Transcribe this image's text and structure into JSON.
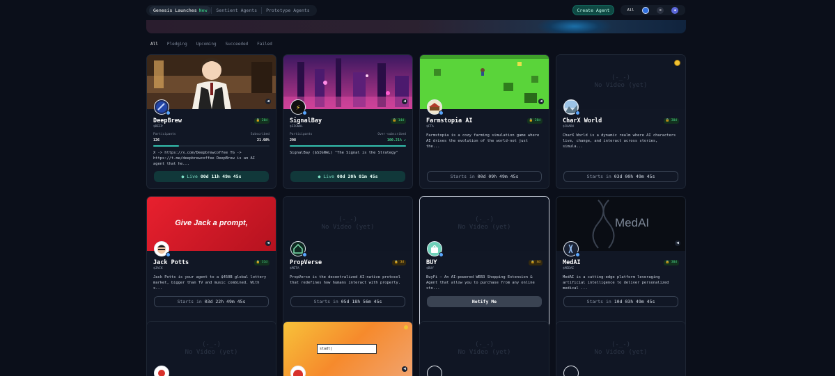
{
  "nav": {
    "tabs": [
      {
        "label": "Genesis Launches",
        "badge": "New"
      },
      {
        "label": "Sentient Agents"
      },
      {
        "label": "Prototype Agents"
      }
    ],
    "create_label": "Create Agent",
    "chain_filter_all": "All"
  },
  "filters": [
    "All",
    "Pledging",
    "Upcoming",
    "Succeeded",
    "Failed"
  ],
  "novideo": {
    "face": "(-_-)",
    "text": "No Video (yet)"
  },
  "cards": [
    {
      "name": "DeepBrew",
      "ticker": "$DEEP",
      "days": "20d",
      "participants_label": "Participants",
      "participants": "126",
      "subscribed_label": "Subscribed",
      "subscribed": "21.98%",
      "progress": 0.22,
      "desc": "X -> https://x.com/Deepbrewcoffee TG -> https://t.me/deepbrewcoffee DeepBrew is an AI agent that he...",
      "cta_prefix": "● Live",
      "cta_time": "00d 11h 49m 45s"
    },
    {
      "name": "SignalBay",
      "ticker": "$SIGNAL",
      "days": "14d",
      "participants_label": "Participants",
      "participants": "298",
      "subscribed_label": "Over-subscribed",
      "subscribed": "100.21%",
      "progress": 1.0,
      "desc": "SignalBay ($SIGNAL) \"The Signal is the Strategy\"",
      "cta_prefix": "● Live",
      "cta_time": "00d 20h 01m 45s"
    },
    {
      "name": "Farmstopia AI",
      "ticker": "$FTA",
      "days": "20d",
      "desc": "Farmstopia is a cozy farming simulation game where AI drives the evolution of the world-not just the...",
      "cta_prefix": "Starts in",
      "cta_time": "00d 09h 49m 45s"
    },
    {
      "name": "CharX World",
      "ticker": "$CHARX",
      "days": "30d",
      "desc": "CharX World is a dynamic realm where AI characters live, change, and interact across stories, simula...",
      "cta_prefix": "Starts in",
      "cta_time": "03d 00h 49m 45s"
    },
    {
      "name": "Jack Potts",
      "ticker": "$JACK",
      "days": "31d",
      "media_text": "Give Jack a prompt,",
      "desc": "Jack Potts is your agent to a $450B global lottery market, bigger than TV and music combined. With s...",
      "cta_prefix": "Starts in",
      "cta_time": "03d 22h 49m 45s"
    },
    {
      "name": "PropVerse",
      "ticker": "$META",
      "days": "3d",
      "desc": "PropVerse is the decentralized AI-native protocol that redefines how humans interact with property.",
      "cta_prefix": "Starts in",
      "cta_time": "05d 18h 56m 45s"
    },
    {
      "name": "BUY",
      "ticker": "$BUY",
      "days": "4d",
      "desc": "BuyFi — An AI-powered WEB3 Shopping Extension & Agent that allow you to purchase from any online sto...",
      "cta_label": "Notify Me"
    },
    {
      "name": "MedAI",
      "ticker": "$MEDAI",
      "days": "30d",
      "media_text": "MedAI",
      "desc": "MedAI is a cutting-edge platform leveraging artificial intelligence to deliver personalized medical ...",
      "cta_prefix": "Starts in",
      "cta_time": "10d 03h 49m 45s"
    }
  ],
  "row3": {
    "input_text": "stadt|"
  },
  "colors": {
    "accent": "#34c2b0",
    "live_bg": "#11383a",
    "bg": "#0b0f1a",
    "card": "#111725"
  }
}
